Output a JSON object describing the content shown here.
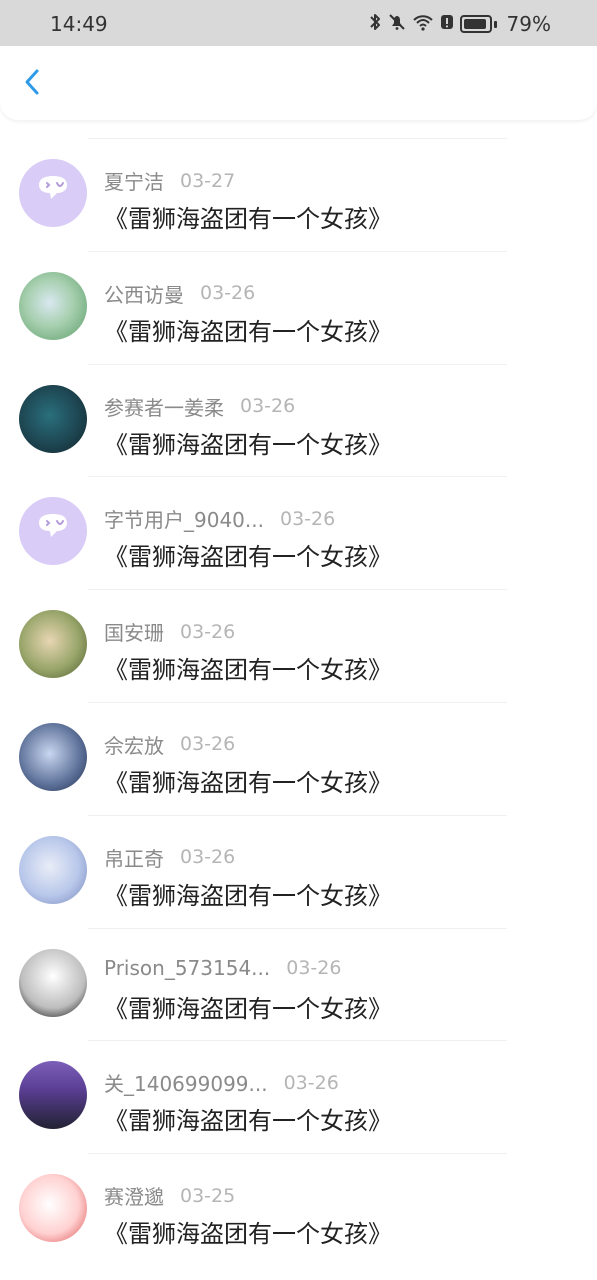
{
  "status_bar": {
    "time": "14:49",
    "battery_percent": "79%",
    "icons": [
      "bluetooth-icon",
      "dnd-icon",
      "wifi-icon",
      "alert-icon",
      "battery-icon"
    ]
  },
  "nav": {
    "back_icon": "chevron-left-icon",
    "accent_color": "#2f9be8"
  },
  "items": [
    {
      "name": "夏宁洁",
      "date": "03-27",
      "message": "《雷狮海盗团有一个女孩》",
      "avatar": "chat-bubble-avatar"
    },
    {
      "name": "公西访曼",
      "date": "03-26",
      "message": "《雷狮海盗团有一个女孩》",
      "avatar": "photo-avatar"
    },
    {
      "name": "参赛者一姜柔",
      "date": "03-26",
      "message": "《雷狮海盗团有一个女孩》",
      "avatar": "photo-avatar"
    },
    {
      "name": "字节用户_9040...",
      "date": "03-26",
      "message": "《雷狮海盗团有一个女孩》",
      "avatar": "chat-bubble-avatar"
    },
    {
      "name": "国安珊",
      "date": "03-26",
      "message": "《雷狮海盗团有一个女孩》",
      "avatar": "photo-avatar"
    },
    {
      "name": "佘宏放",
      "date": "03-26",
      "message": "《雷狮海盗团有一个女孩》",
      "avatar": "photo-avatar"
    },
    {
      "name": "帛正奇",
      "date": "03-26",
      "message": "《雷狮海盗团有一个女孩》",
      "avatar": "photo-avatar"
    },
    {
      "name": "Prison_573154...",
      "date": "03-26",
      "message": "《雷狮海盗团有一个女孩》",
      "avatar": "photo-avatar"
    },
    {
      "name": "关_140699099...",
      "date": "03-26",
      "message": "《雷狮海盗团有一个女孩》",
      "avatar": "photo-avatar"
    },
    {
      "name": "赛澄邈",
      "date": "03-25",
      "message": "《雷狮海盗团有一个女孩》",
      "avatar": "photo-avatar"
    }
  ]
}
